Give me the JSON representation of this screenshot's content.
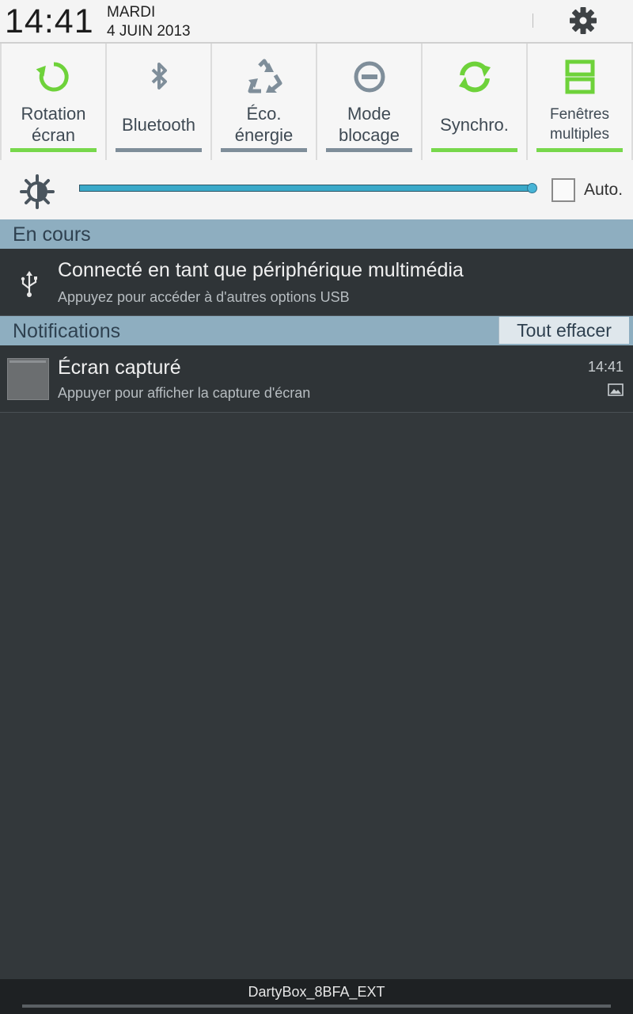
{
  "status": {
    "time": "14:41",
    "day": "MARDI",
    "date": "4 JUIN 2013",
    "settings_icon": "gear-icon"
  },
  "toggles": [
    {
      "label": "Rotation écran",
      "icon": "rotation-icon",
      "active": true
    },
    {
      "label": "Bluetooth",
      "icon": "bluetooth-icon",
      "active": false
    },
    {
      "label": "Éco. énergie",
      "icon": "recycle-icon",
      "active": false
    },
    {
      "label": "Mode blocage",
      "icon": "block-icon",
      "active": false
    },
    {
      "label": "Synchro.",
      "icon": "sync-icon",
      "active": true
    },
    {
      "label": "Fenêtres multiples",
      "icon": "multi-window-icon",
      "active": true
    }
  ],
  "brightness": {
    "level": 1.0,
    "auto_label": "Auto.",
    "auto_checked": false
  },
  "ongoing": {
    "header": "En cours",
    "title": "Connecté en tant que périphérique multimédia",
    "subtitle": "Appuyez pour accéder à d'autres options USB"
  },
  "notifications": {
    "header": "Notifications",
    "clear_label": "Tout effacer",
    "items": [
      {
        "title": "Écran capturé",
        "subtitle": "Appuyer pour afficher la capture d'écran",
        "time": "14:41"
      }
    ]
  },
  "footer": {
    "network": "DartyBox_8BFA_EXT"
  },
  "colors": {
    "accent_on": "#78d84c",
    "accent_off": "#7f8e9a",
    "section_bg": "#8eaec0",
    "panel_bg": "#33383b"
  }
}
